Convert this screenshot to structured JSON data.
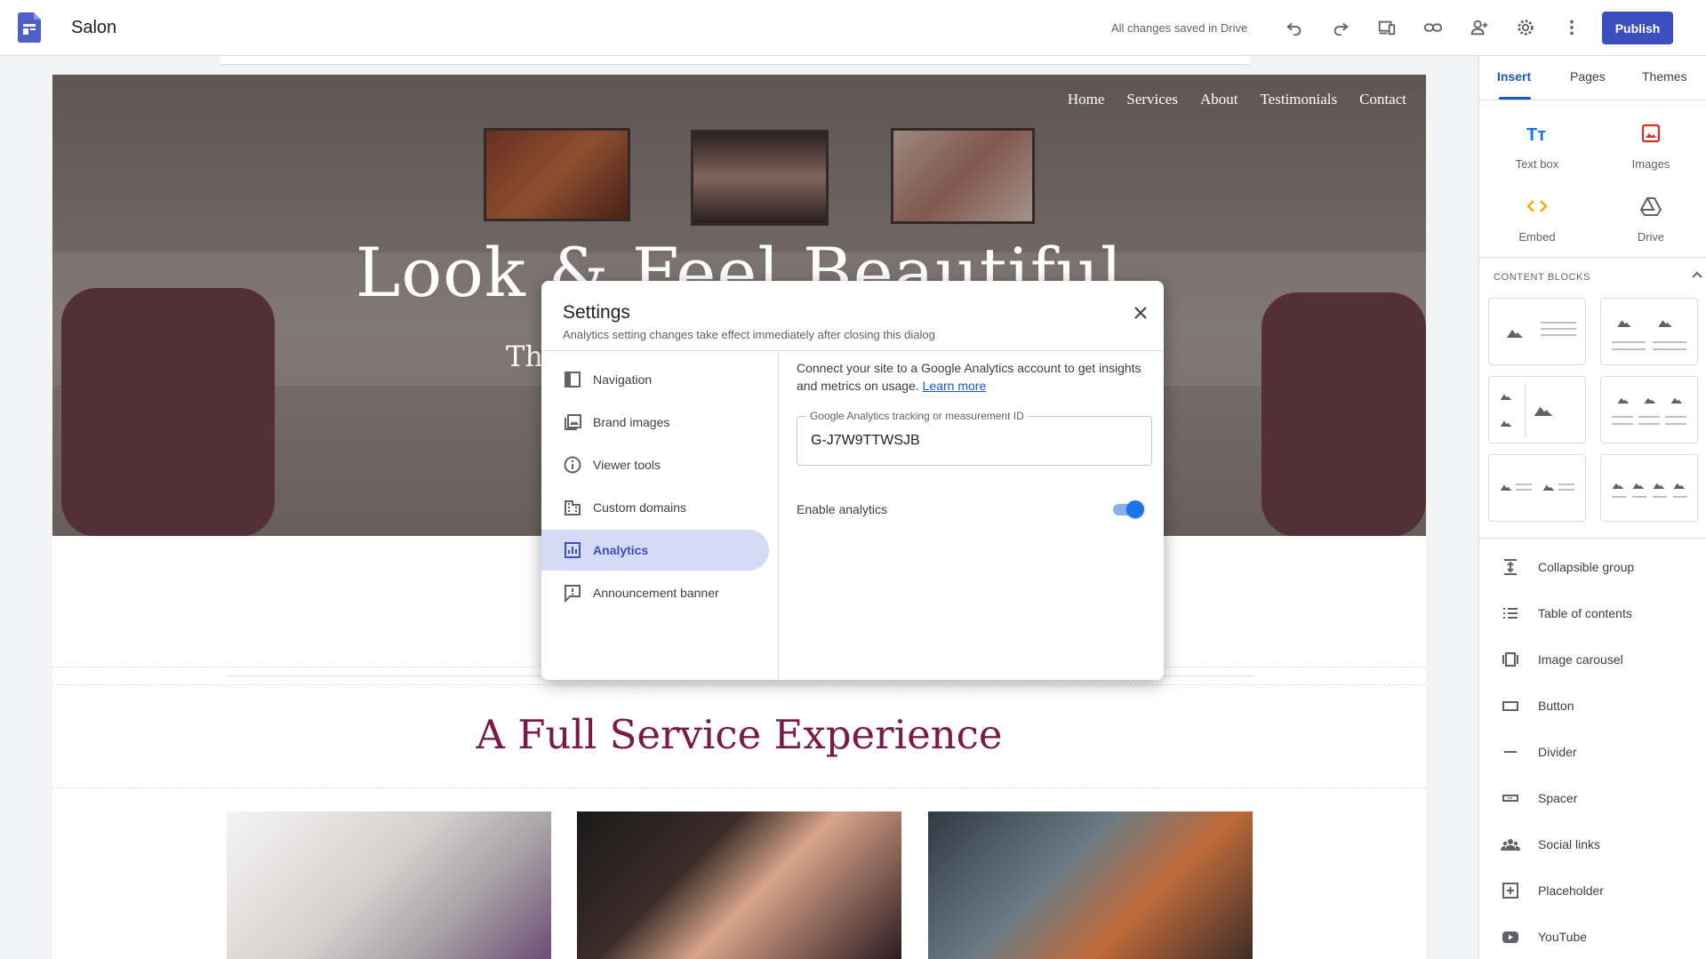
{
  "app": {
    "title": "Salon",
    "save_status": "All changes saved in Drive",
    "publish_label": "Publish"
  },
  "site": {
    "nav": [
      "Home",
      "Services",
      "About",
      "Testimonials",
      "Contact"
    ],
    "hero_title": "Look & Feel Beautiful",
    "hero_subtitle": "Th",
    "section_title": "A Full Service Experience"
  },
  "right_panel": {
    "tabs": [
      "Insert",
      "Pages",
      "Themes"
    ],
    "insert_tiles": [
      "Text box",
      "Images",
      "Embed",
      "Drive"
    ],
    "content_blocks_header": "CONTENT BLOCKS",
    "items": [
      "Collapsible group",
      "Table of contents",
      "Image carousel",
      "Button",
      "Divider",
      "Spacer",
      "Social links",
      "Placeholder",
      "YouTube"
    ]
  },
  "settings_dialog": {
    "title": "Settings",
    "subtitle": "Analytics setting changes take effect immediately after closing this dialog",
    "nav": [
      "Navigation",
      "Brand images",
      "Viewer tools",
      "Custom domains",
      "Analytics",
      "Announcement banner"
    ],
    "active_nav": "Analytics",
    "description": "Connect your site to a Google Analytics account to get insights and metrics on usage.",
    "learn_more": "Learn more",
    "field_label": "Google Analytics tracking or measurement ID",
    "field_value": "G-J7W9TTWSJB",
    "toggle_label": "Enable analytics",
    "toggle_on": true
  },
  "colors": {
    "accent": "#3c4fbf",
    "link": "#1a57c9",
    "section_title": "#7a1b47"
  }
}
